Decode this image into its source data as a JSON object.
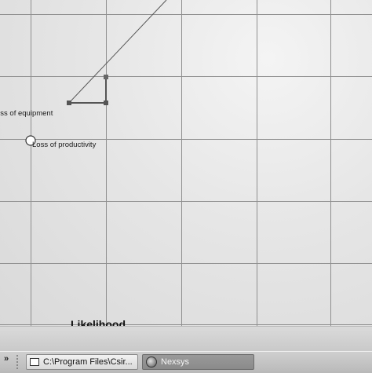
{
  "chart": {
    "axis_title": "Likelihood",
    "risk_items": [
      {
        "label": "Loss of equipment",
        "shown_text": "oss of equipment"
      },
      {
        "label": "Loss of productivity",
        "shown_text": "Loss of productivity"
      }
    ]
  },
  "taskbar": {
    "overflow_symbol": "»",
    "tasks": [
      {
        "label": "C:\\Program Files\\Csir...",
        "icon": "folder-window-icon",
        "active": false
      },
      {
        "label": "Nexsys",
        "icon": "nexsys-app-icon",
        "active": true
      }
    ]
  }
}
